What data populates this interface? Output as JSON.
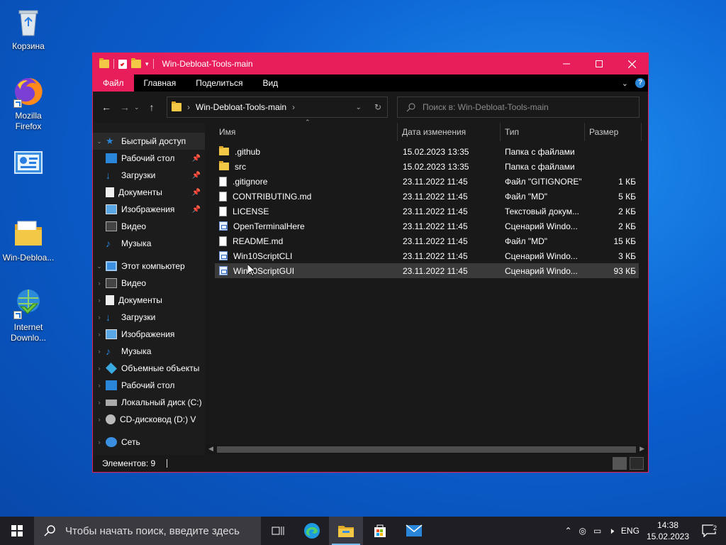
{
  "desktop": {
    "icons": [
      {
        "label": "Корзина"
      },
      {
        "label": "Mozilla Firefox"
      },
      {
        "label": ""
      },
      {
        "label": "Win-Debloa..."
      },
      {
        "label": "Internet Downlo..."
      }
    ]
  },
  "window": {
    "title": "Win-Debloat-Tools-main",
    "ribbon_tabs": [
      "Файл",
      "Главная",
      "Поделиться",
      "Вид"
    ],
    "address": {
      "path": "Win-Debloat-Tools-main"
    },
    "search": {
      "placeholder": "Поиск в: Win-Debloat-Tools-main"
    },
    "nav": {
      "quick_access": "Быстрый доступ",
      "quick_items": [
        "Рабочий стол",
        "Загрузки",
        "Документы",
        "Изображения",
        "Видео",
        "Музыка"
      ],
      "this_pc": "Этот компьютер",
      "pc_items": [
        "Видео",
        "Документы",
        "Загрузки",
        "Изображения",
        "Музыка",
        "Объемные объекты",
        "Рабочий стол",
        "Локальный диск (C:)",
        "CD-дисковод (D:) V"
      ],
      "network": "Сеть"
    },
    "columns": {
      "name": "Имя",
      "date": "Дата изменения",
      "type": "Тип",
      "size": "Размер"
    },
    "files": [
      {
        "name": ".github",
        "date": "15.02.2023 13:35",
        "type": "Папка с файлами",
        "size": "",
        "icon": "folder"
      },
      {
        "name": "src",
        "date": "15.02.2023 13:35",
        "type": "Папка с файлами",
        "size": "",
        "icon": "folder"
      },
      {
        "name": ".gitignore",
        "date": "23.11.2022 11:45",
        "type": "Файл \"GITIGNORE\"",
        "size": "1 КБ",
        "icon": "file"
      },
      {
        "name": "CONTRIBUTING.md",
        "date": "23.11.2022 11:45",
        "type": "Файл \"MD\"",
        "size": "5 КБ",
        "icon": "file"
      },
      {
        "name": "LICENSE",
        "date": "23.11.2022 11:45",
        "type": "Текстовый докум...",
        "size": "2 КБ",
        "icon": "file"
      },
      {
        "name": "OpenTerminalHere",
        "date": "23.11.2022 11:45",
        "type": "Сценарий Windo...",
        "size": "2 КБ",
        "icon": "script"
      },
      {
        "name": "README.md",
        "date": "23.11.2022 11:45",
        "type": "Файл \"MD\"",
        "size": "15 КБ",
        "icon": "file"
      },
      {
        "name": "Win10ScriptCLI",
        "date": "23.11.2022 11:45",
        "type": "Сценарий Windo...",
        "size": "3 КБ",
        "icon": "script"
      },
      {
        "name": "Win10ScriptGUI",
        "date": "23.11.2022 11:45",
        "type": "Сценарий Windo...",
        "size": "93 КБ",
        "icon": "script"
      }
    ],
    "selected_file_index": 8,
    "status": {
      "items": "Элементов: 9"
    },
    "accent_color": "#e81e5a"
  },
  "taskbar": {
    "search_placeholder": "Чтобы начать поиск, введите здесь",
    "lang": "ENG",
    "time": "14:38",
    "date": "15.02.2023",
    "notification_count": "2"
  }
}
